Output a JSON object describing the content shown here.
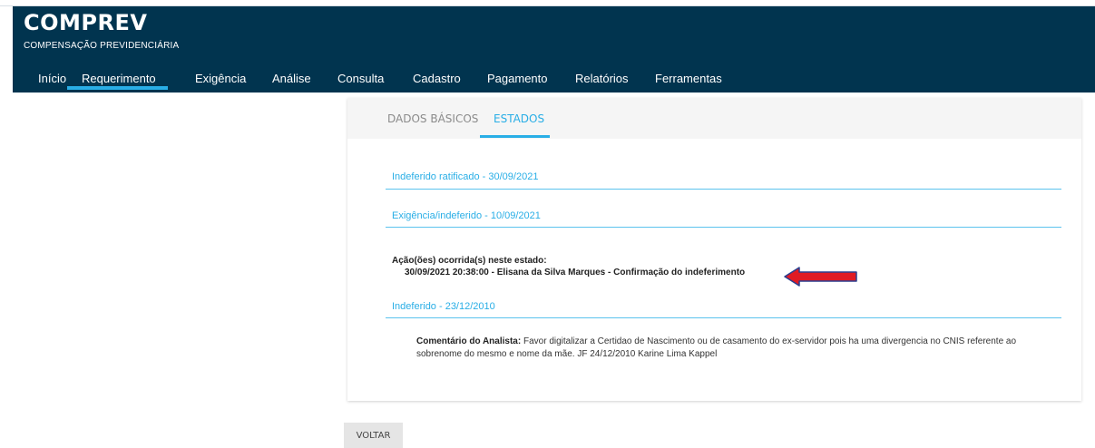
{
  "app": {
    "title": "COMPREV",
    "subtitle": "COMPENSAÇÃO PREVIDENCIÁRIA"
  },
  "nav": {
    "items": [
      "Início",
      "Requerimento",
      "Exigência",
      "Análise",
      "Consulta",
      "Cadastro",
      "Pagamento",
      "Relatórios",
      "Ferramentas"
    ],
    "active": "Requerimento"
  },
  "tabs": {
    "items": [
      "DADOS BÁSICOS",
      "ESTADOS"
    ],
    "active": "ESTADOS"
  },
  "states": [
    {
      "title": "Indeferido ratificado - 30/09/2021"
    },
    {
      "title": "Exigência/indeferido - 10/09/2021"
    },
    {
      "title": "Indeferido - 23/12/2010"
    }
  ],
  "actions": {
    "heading": "Ação(ões) ocorrida(s) neste estado:",
    "entry": "30/09/2021 20:38:00 - Elisana da Silva Marques - Confirmação do indeferimento"
  },
  "comment": {
    "label": "Comentário do Analista:",
    "text": " Favor digitalizar a Certidao de Nascimento ou de casamento do ex-servidor pois ha uma divergencia no CNIS referente ao sobrenome do mesmo e nome da mãe. JF 24/12/2010 Karine Lima Kappel"
  },
  "buttons": {
    "back": "VOLTAR"
  },
  "colors": {
    "header_bg": "#01344f",
    "accent": "#29aee6",
    "arrow_red": "#e01b24",
    "arrow_outline": "#2a3f8f"
  },
  "icons": {
    "annotation_arrow": "red-left-arrow-icon"
  }
}
